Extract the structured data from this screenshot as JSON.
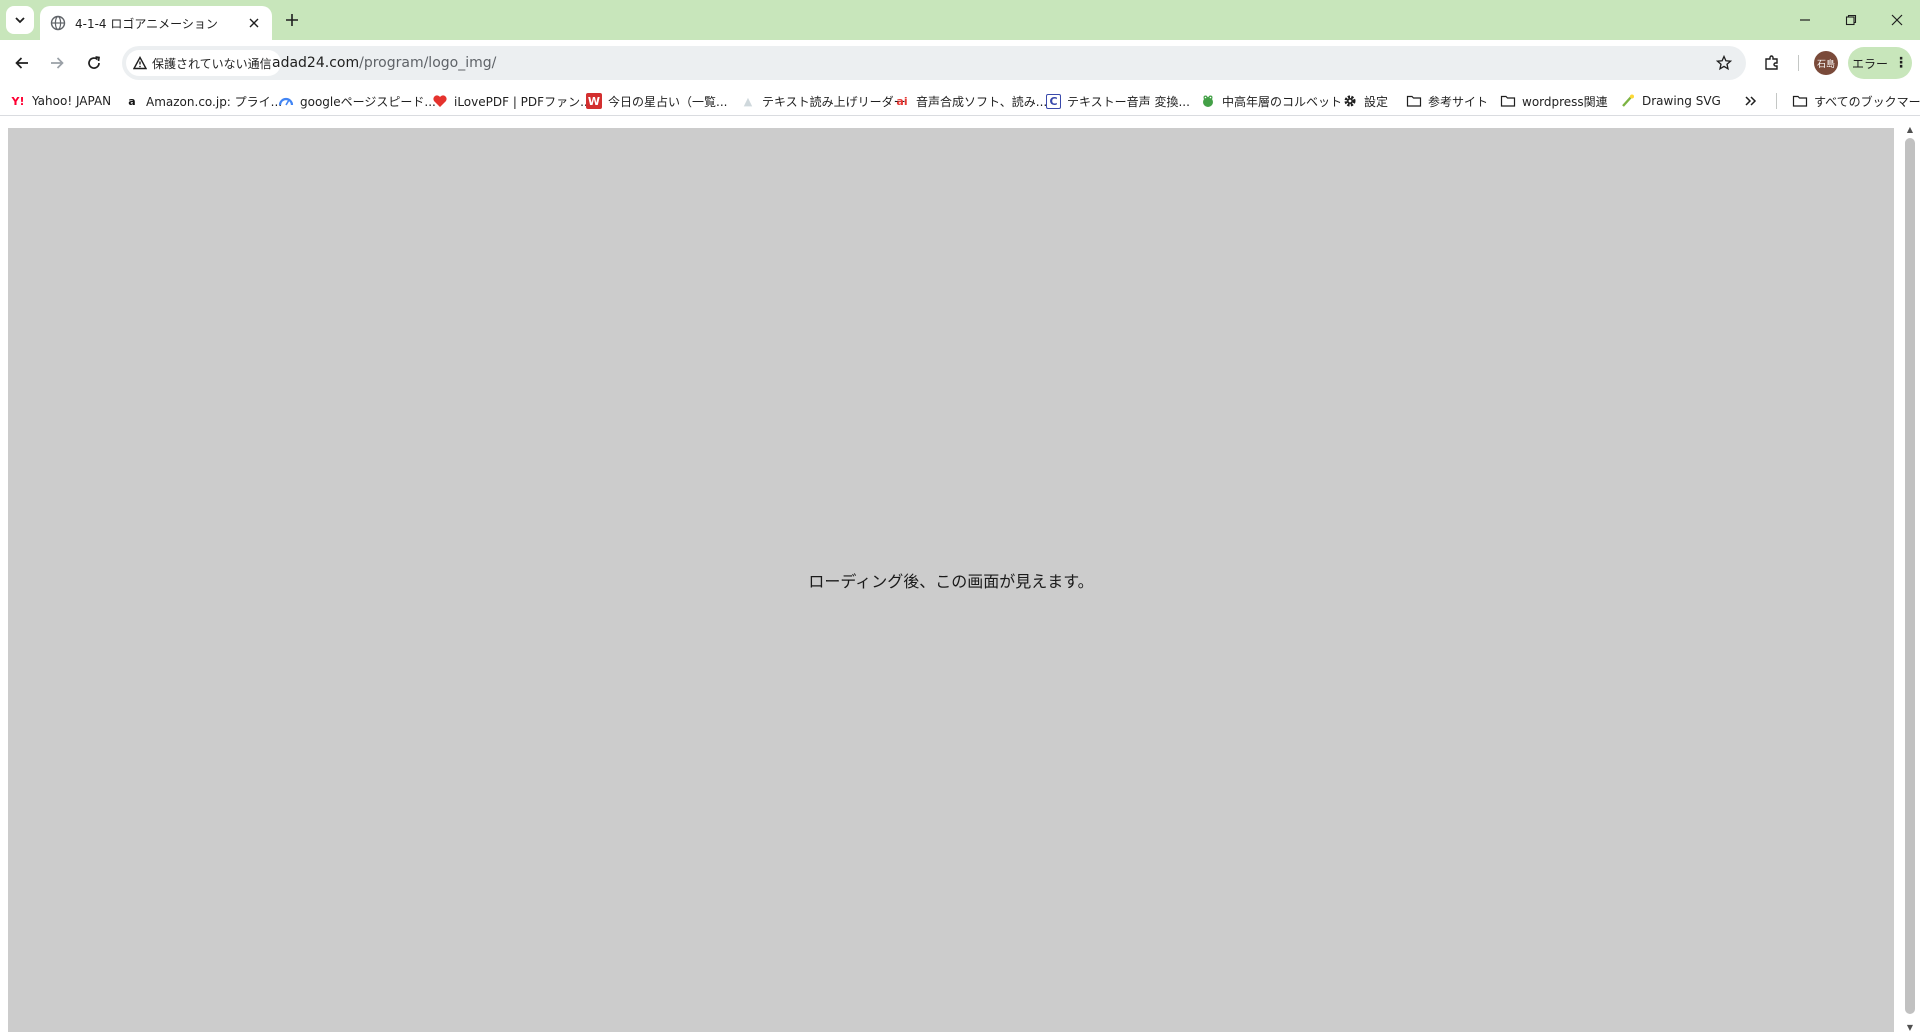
{
  "browser": {
    "tab": {
      "title": "4-1-4 ロゴアニメーション"
    },
    "address": {
      "security_label": "保護されていない通信",
      "url_host": "adad24.com",
      "url_path": "/program/logo_img/"
    },
    "profile": {
      "avatar_label": "石島"
    },
    "error_chip": {
      "label": "エラー"
    },
    "bookmarks": [
      {
        "label": "Yahoo! JAPAN",
        "icon": "yahoo-icon"
      },
      {
        "label": "Amazon.co.jp: プライ...",
        "icon": "amazon-icon"
      },
      {
        "label": "googleページスピード...",
        "icon": "pagespeed-icon"
      },
      {
        "label": "iLovePDF | PDFファン...",
        "icon": "ilovepdf-icon"
      },
      {
        "label": "今日の星占い（一覧...",
        "icon": "horoscope-icon"
      },
      {
        "label": "テキスト読み上げリーダー",
        "icon": "tts-icon"
      },
      {
        "label": "音声合成ソフト、読み...",
        "icon": "ai-voice-icon"
      },
      {
        "label": "テキストー音声 変換...",
        "icon": "c-icon"
      },
      {
        "label": "中高年層のコルベット",
        "icon": "frog-icon"
      },
      {
        "label": "設定",
        "icon": "gear-icon"
      },
      {
        "label": "参考サイト",
        "icon": "folder-icon"
      },
      {
        "label": "wordpress関連",
        "icon": "folder-icon"
      },
      {
        "label": "Drawing SVG",
        "icon": "svg-icon"
      }
    ],
    "all_bookmarks_label": "すべてのブックマーク"
  },
  "page": {
    "message": "ローディング後、この画面が見えます。",
    "background_color": "#cccccc"
  },
  "colors": {
    "tabstrip": "#c8e6bb",
    "omnibox": "#eceff1"
  }
}
